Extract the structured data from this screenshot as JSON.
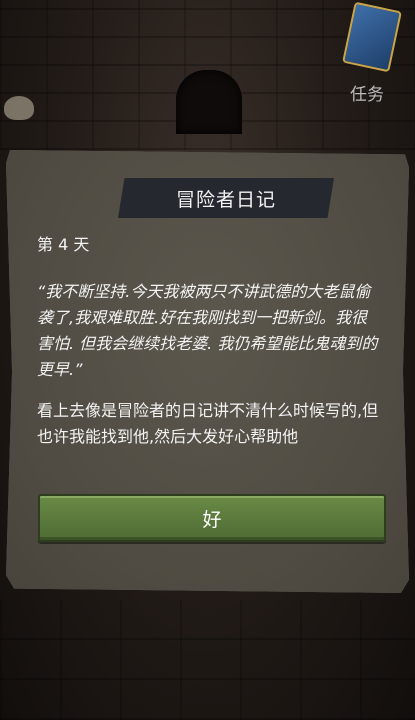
{
  "hud": {
    "quest_label": "任务"
  },
  "dialog": {
    "title": "冒险者日记",
    "day": "第 4 天",
    "quote": "“我不断坚持.今天我被两只不讲武德的大老鼠偷袭了,我艰难取胜.好在我刚找到一把新剑。我很害怕. 但我会继续找老婆. 我仍希望能比鬼魂到的更早.”",
    "description": "看上去像是冒险者的日记讲不清什么时候写的,但也许我能找到他,然后大发好心帮助他",
    "ok_label": "好"
  },
  "colors": {
    "parchment": "#4f4b42",
    "ribbon": "#25292f",
    "button": "#5b7b3d"
  }
}
